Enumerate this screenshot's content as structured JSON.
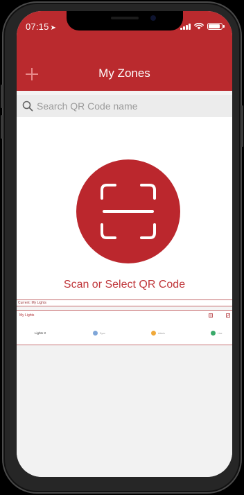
{
  "status_bar": {
    "time": "07:15",
    "nav_arrow": "➤"
  },
  "header": {
    "title": "My Zones",
    "add_icon": "plus-icon",
    "color": "#ba2a2e"
  },
  "search": {
    "placeholder": "Search QR Code name",
    "value": ""
  },
  "scan": {
    "label": "Scan or Select QR Code",
    "icon": "qr-scan-icon",
    "color": "#bb272d"
  },
  "current": {
    "label": "Current: My Lights"
  },
  "zone": {
    "name": "My Lights",
    "light_label": "Lights X",
    "statuses": [
      {
        "label": "Sync",
        "color": "#7fa6d8"
      },
      {
        "label": "Admin",
        "color": "#f0a93a"
      },
      {
        "label": "Live",
        "color": "#3aaa6a"
      }
    ]
  }
}
